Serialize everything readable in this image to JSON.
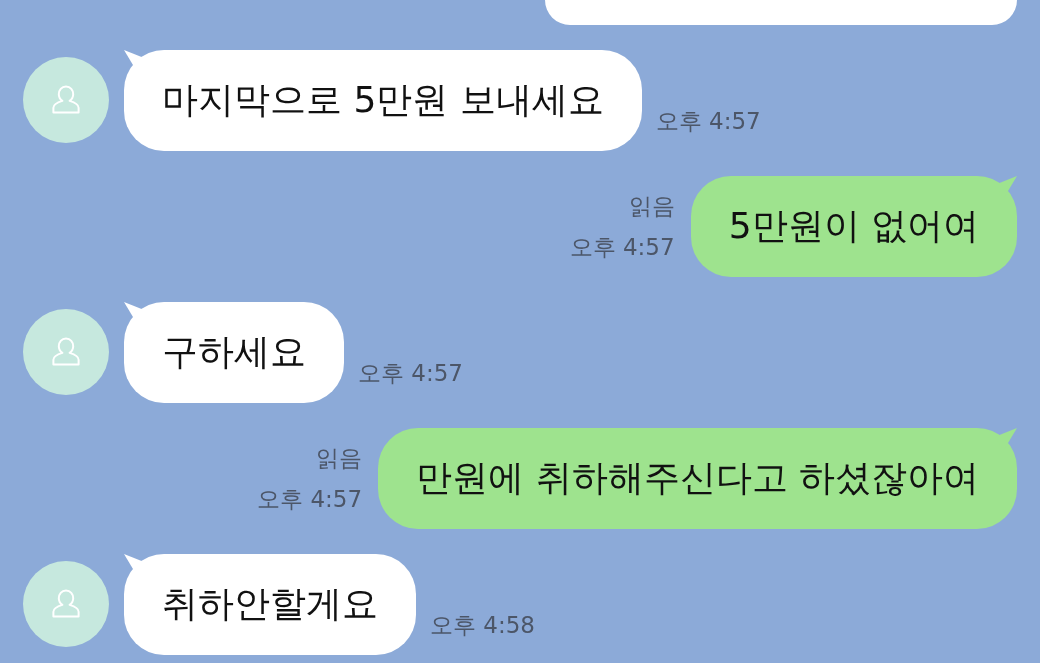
{
  "messages": [
    {
      "kind": "card"
    },
    {
      "kind": "text",
      "outgoing": false,
      "text": "마지막으로 5만원 보내세요",
      "time": "오후 4:57"
    },
    {
      "kind": "text",
      "outgoing": true,
      "text": "5만원이 없어여",
      "read": "읽음",
      "time": "오후 4:57"
    },
    {
      "kind": "text",
      "outgoing": false,
      "text": "구하세요",
      "time": "오후 4:57"
    },
    {
      "kind": "text",
      "outgoing": true,
      "text": "만원에 취하해주신다고 하셨잖아여",
      "read": "읽음",
      "time": "오후 4:57"
    },
    {
      "kind": "text",
      "outgoing": false,
      "text": "취하안할게요",
      "time": "오후 4:58"
    }
  ]
}
